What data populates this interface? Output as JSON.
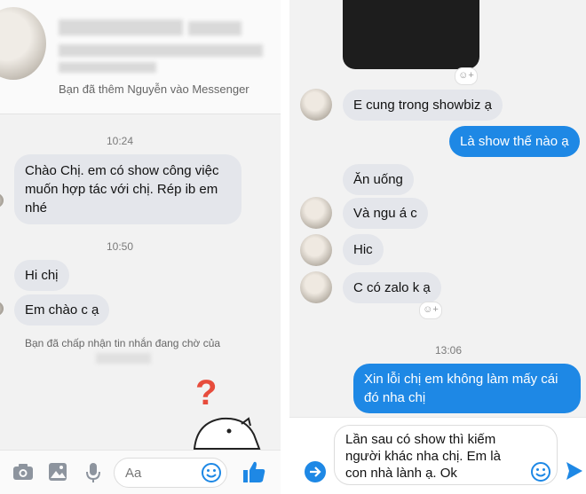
{
  "left": {
    "profile": {
      "subtitle_blurred": "nơi trên Facebook",
      "added_notice": "Bạn đã thêm Nguyễn vào Messenger"
    },
    "messages": [
      {
        "time": "10:24"
      },
      {
        "text_lines": [
          "Chào Chị. em có show công việc",
          "muốn hợp tác với chị. Rép ib em",
          "nhé"
        ]
      },
      {
        "time": "10:50"
      },
      {
        "text": "Hi chị"
      },
      {
        "text": "Em chào c ạ"
      }
    ],
    "system_notice": "Bạn đã chấp nhận tin nhắn đang chờ của",
    "composer": {
      "placeholder": "Aa",
      "icons": [
        "camera-icon",
        "image-icon",
        "microphone-icon",
        "emoji-icon",
        "thumbs-up-icon"
      ]
    }
  },
  "right": {
    "messages": [
      {
        "side": "in",
        "text": "E cung trong showbiz ạ"
      },
      {
        "side": "out",
        "text": "Là show thế nào ạ"
      },
      {
        "side": "in",
        "text": "Ăn uống"
      },
      {
        "side": "in",
        "text": "Và ngu á c"
      },
      {
        "side": "in",
        "text": "Hic"
      },
      {
        "side": "in",
        "text": "C có zalo k ạ"
      },
      {
        "time": "13:06"
      },
      {
        "side": "out",
        "text_lines": [
          "Xin lỗi chị em không làm mấy cái",
          "đó nha chị"
        ]
      }
    ],
    "composer": {
      "draft_lines": [
        "Lần sau có show thì kiếm",
        "người khác nha chị. Em là",
        "con nhà lành ạ. Ok"
      ],
      "icons": [
        "arrow-right-icon",
        "emoji-icon",
        "send-icon"
      ]
    }
  },
  "colors": {
    "accent": "#1e88e5",
    "incoming": "#e4e6eb",
    "background": "#f2f2f2"
  }
}
